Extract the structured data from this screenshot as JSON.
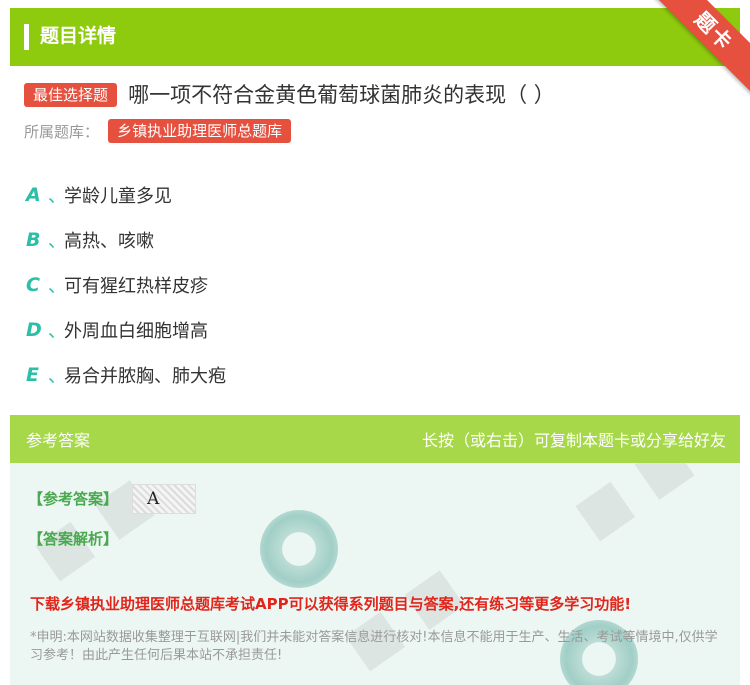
{
  "header": {
    "title": "题目详情",
    "ribbon_label": "题卡"
  },
  "question": {
    "type_tag": "最佳选择题",
    "text": "哪一项不符合金黄色葡萄球菌肺炎的表现（ ）",
    "bank_label": "所属题库：",
    "bank_name": "乡镇执业助理医师总题库"
  },
  "options": [
    {
      "letter": "A",
      "sep": "、",
      "text": "学龄儿童多见"
    },
    {
      "letter": "B",
      "sep": "、",
      "text": "高热、咳嗽"
    },
    {
      "letter": "C",
      "sep": "、",
      "text": "可有猩红热样皮疹"
    },
    {
      "letter": "D",
      "sep": "、",
      "text": "外周血白细胞增高"
    },
    {
      "letter": "E",
      "sep": "、",
      "text": "易合并脓胸、肺大疱"
    }
  ],
  "answer": {
    "section_title": "参考答案",
    "hint": "长按（或右击）可复制本题卡或分享给好友",
    "answer_label": "【参考答案】",
    "answer_value": "A",
    "explanation_label": "【答案解析】",
    "promo": "下载乡镇执业助理医师总题库考试APP可以获得系列题目与答案,还有练习等更多学习功能!",
    "disclaimer": "*申明:本网站数据收集整理于互联网|我们并未能对答案信息进行核对!本信息不能用于生产、生活、考试等情境中,仅供学习参考！由此产生任何后果本站不承担责任!"
  },
  "colors": {
    "header_green": "#8ecb0e",
    "tag_red": "#e5503f",
    "option_teal": "#2bbfa5",
    "answer_head_green": "#a6d84a",
    "answer_bg": "#ecf7f3",
    "promo_red": "#e1251b"
  }
}
